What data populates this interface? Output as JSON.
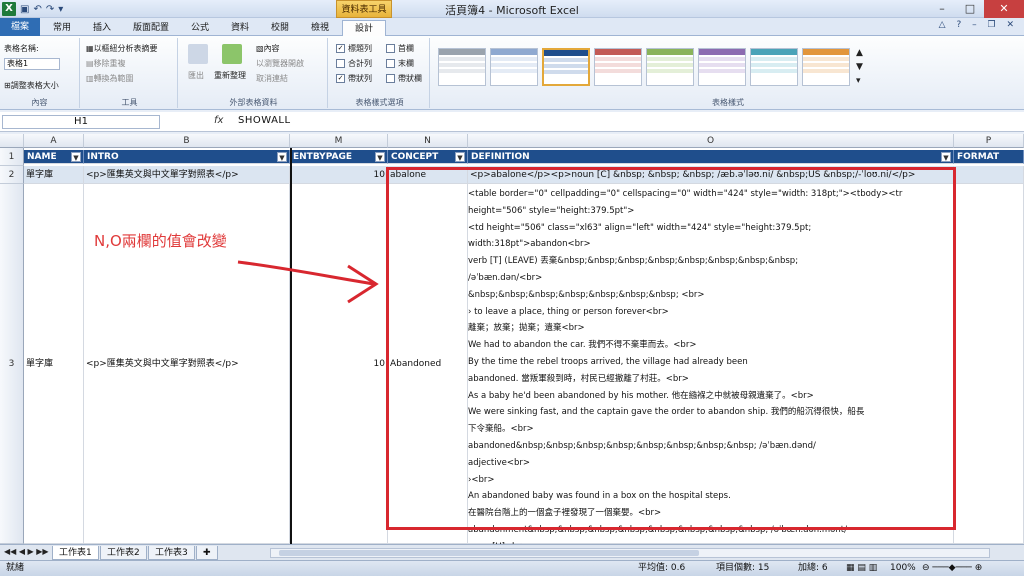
{
  "window": {
    "title": "活頁簿4 - Microsoft Excel",
    "context_tab": "資料表工具"
  },
  "tabs": [
    {
      "label": "檔案"
    },
    {
      "label": "常用"
    },
    {
      "label": "插入"
    },
    {
      "label": "版面配置"
    },
    {
      "label": "公式"
    },
    {
      "label": "資料"
    },
    {
      "label": "校閱"
    },
    {
      "label": "檢視"
    },
    {
      "label": "設計"
    }
  ],
  "ribbon": {
    "properties": {
      "name_label": "表格名稱:",
      "name_value": "表格1",
      "resize": "調整表格大小",
      "group": "內容"
    },
    "tools": {
      "pivot": "以樞紐分析表摘要",
      "remove_dup": "移除重複",
      "convert": "轉換為範圍",
      "group": "工具"
    },
    "external": {
      "export": "匯出",
      "refresh": "重新整理",
      "properties": "內容",
      "open_browser": "以瀏覽器開啟",
      "unlink": "取消連結",
      "group": "外部表格資料"
    },
    "options": {
      "header_row": "標題列",
      "total_row": "合計列",
      "banded_rows": "帶狀列",
      "first_col": "首欄",
      "last_col": "末欄",
      "banded_cols": "帶狀欄",
      "group": "表格樣式選項"
    },
    "styles": {
      "group": "表格樣式"
    }
  },
  "formula_bar": {
    "name_box": "H1",
    "fx": "fx",
    "formula": "SHOWALL"
  },
  "columns": [
    "A",
    "B",
    "M",
    "N",
    "O",
    "P"
  ],
  "row_numbers": [
    "1",
    "2",
    "3"
  ],
  "headers": [
    "NAME",
    "INTRO",
    "ENTBYPAGE",
    "CONCEPT",
    "DEFINITION",
    "FORMAT"
  ],
  "row2": {
    "name": "單字庫",
    "intro": "<p>匯集英文與中文單字對照表</p>",
    "page": "10",
    "concept": "abalone",
    "definition": "<p>abalone</p><p>noun [C] &nbsp; &nbsp; &nbsp; /æb.əˈləʊ.ni/ &nbsp;US &nbsp;/-ˈloʊ.ni/</p>"
  },
  "row3": {
    "name": "單字庫",
    "intro": "<p>匯集英文與中文單字對照表</p>",
    "page": "10",
    "concept": "Abandoned",
    "definition_lines": [
      "<table border=\"0\" cellpadding=\"0\" cellspacing=\"0\" width=\"424\" style=\"width: 318pt;\"><tbody><tr",
      "height=\"506\" style=\"height:379.5pt\">",
      "  <td height=\"506\" class=\"xl63\" align=\"left\" width=\"424\" style=\"height:379.5pt;",
      "  width:318pt\">abandon<br>",
      "    verb [T] (LEAVE) 丟棄&nbsp;&nbsp;&nbsp;&nbsp;&nbsp;&nbsp;&nbsp;&nbsp;",
      "  /əˈbæn.dən/<br>",
      "    &nbsp;&nbsp;&nbsp;&nbsp;&nbsp;&nbsp;&nbsp; <br>",
      "    › to leave a place, thing or person forever<br>",
      "    離棄；放棄；拋棄；遺棄<br>",
      "    We had to abandon the car. 我們不得不棄車而去。<br>",
      "    By the time the rebel troops arrived, the village had already been",
      "  abandoned. 當叛軍殺到時，村民已經撤離了村莊。<br>",
      "    As a baby he'd been abandoned by his mother. 他在繈褓之中就被母親遺棄了。<br>",
      "    We were sinking fast, and the captain gave the order to abandon ship. 我們的船沉得很快，船長",
      "下令棄船。<br>",
      "    abandoned&nbsp;&nbsp;&nbsp;&nbsp;&nbsp;&nbsp;&nbsp;&nbsp; /əˈbæn.dənd/",
      "  adjective<br>",
      "    ›<br>",
      "    An abandoned baby was found in a box on the hospital steps.",
      "   在醫院台階上的一個盒子裡發現了一個棄嬰。<br>",
      "    abandonment&nbsp;&nbsp;&nbsp;&nbsp;&nbsp;&nbsp;&nbsp;&nbsp; /əˈbæn.dən.mənt/",
      "  noun [U]<br>"
    ]
  },
  "annotation": "N,O兩欄的值會改變",
  "sheets": [
    "工作表1",
    "工作表2",
    "工作表3"
  ],
  "status": {
    "ready": "就緒",
    "average": "平均值: 0.6",
    "count": "項目個數: 15",
    "sum": "加總: 6",
    "zoom": "100%"
  },
  "colors": {
    "header_bg": "#1f4e8c",
    "accent_red": "#d8272f",
    "file_tab": "#2f6db4"
  }
}
